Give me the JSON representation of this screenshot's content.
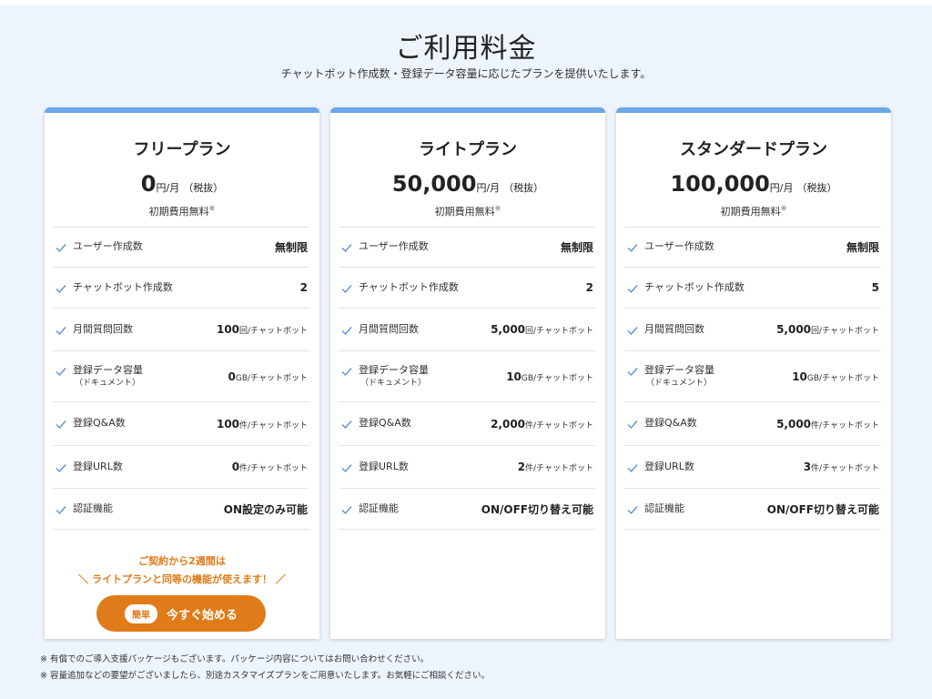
{
  "header": {
    "title": "ご利用料金",
    "subtitle": "チャットボット作成数・登録データ容量に応じたプランを提供いたします。"
  },
  "colors": {
    "accent": "#6aa7e8",
    "cta": "#e07b1a",
    "background": "#eef4fb"
  },
  "icons": {
    "check": "check-icon"
  },
  "plans": [
    {
      "name": "フリープラン",
      "price": "0",
      "price_unit": "円/月",
      "tax": "（税抜）",
      "initial": "初期費用無料",
      "initial_mark": "※",
      "features": [
        {
          "label": "ユーザー作成数",
          "value": "無制限",
          "unit": ""
        },
        {
          "label": "チャットボット作成数",
          "value": "2",
          "unit": ""
        },
        {
          "label": "月間質問回数",
          "value": "100",
          "unit": "回/チャットボット"
        },
        {
          "label": "登録データ容量",
          "sub": "（ドキュメント）",
          "value": "0",
          "unit": "GB/チャットボット"
        },
        {
          "label": "登録Q&A数",
          "value": "100",
          "unit": "件/チャットボット"
        },
        {
          "label": "登録URL数",
          "value": "0",
          "unit": "件/チャットボット"
        },
        {
          "label": "認証機能",
          "value": "ON設定のみ可能",
          "unit": ""
        }
      ],
      "promo_line1": "ご契約から2週間は",
      "promo_line2": "＼ ライトプランと同等の機能が使えます！ ／",
      "cta_badge": "簡単",
      "cta_label": "今すぐ始める"
    },
    {
      "name": "ライトプラン",
      "price": "50,000",
      "price_unit": "円/月",
      "tax": "（税抜）",
      "initial": "初期費用無料",
      "initial_mark": "※",
      "features": [
        {
          "label": "ユーザー作成数",
          "value": "無制限",
          "unit": ""
        },
        {
          "label": "チャットボット作成数",
          "value": "2",
          "unit": ""
        },
        {
          "label": "月間質問回数",
          "value": "5,000",
          "unit": "回/チャットボット"
        },
        {
          "label": "登録データ容量",
          "sub": "（ドキュメント）",
          "value": "10",
          "unit": "GB/チャットボット"
        },
        {
          "label": "登録Q&A数",
          "value": "2,000",
          "unit": "件/チャットボット"
        },
        {
          "label": "登録URL数",
          "value": "2",
          "unit": "件/チャットボット"
        },
        {
          "label": "認証機能",
          "value": "ON/OFF切り替え可能",
          "unit": ""
        }
      ]
    },
    {
      "name": "スタンダードプラン",
      "price": "100,000",
      "price_unit": "円/月",
      "tax": "（税抜）",
      "initial": "初期費用無料",
      "initial_mark": "※",
      "features": [
        {
          "label": "ユーザー作成数",
          "value": "無制限",
          "unit": ""
        },
        {
          "label": "チャットボット作成数",
          "value": "5",
          "unit": ""
        },
        {
          "label": "月間質問回数",
          "value": "5,000",
          "unit": "回/チャットボット"
        },
        {
          "label": "登録データ容量",
          "sub": "（ドキュメント）",
          "value": "10",
          "unit": "GB/チャットボット"
        },
        {
          "label": "登録Q&A数",
          "value": "5,000",
          "unit": "件/チャットボット"
        },
        {
          "label": "登録URL数",
          "value": "3",
          "unit": "件/チャットボット"
        },
        {
          "label": "認証機能",
          "value": "ON/OFF切り替え可能",
          "unit": ""
        }
      ]
    }
  ],
  "notes": [
    "※ 有償でのご導入支援パッケージもございます。パッケージ内容についてはお問い合わせください。",
    "※ 容量追加などの要望がございましたら、別途カスタマイズプランをご用意いたします。お気軽にご相談ください。"
  ]
}
